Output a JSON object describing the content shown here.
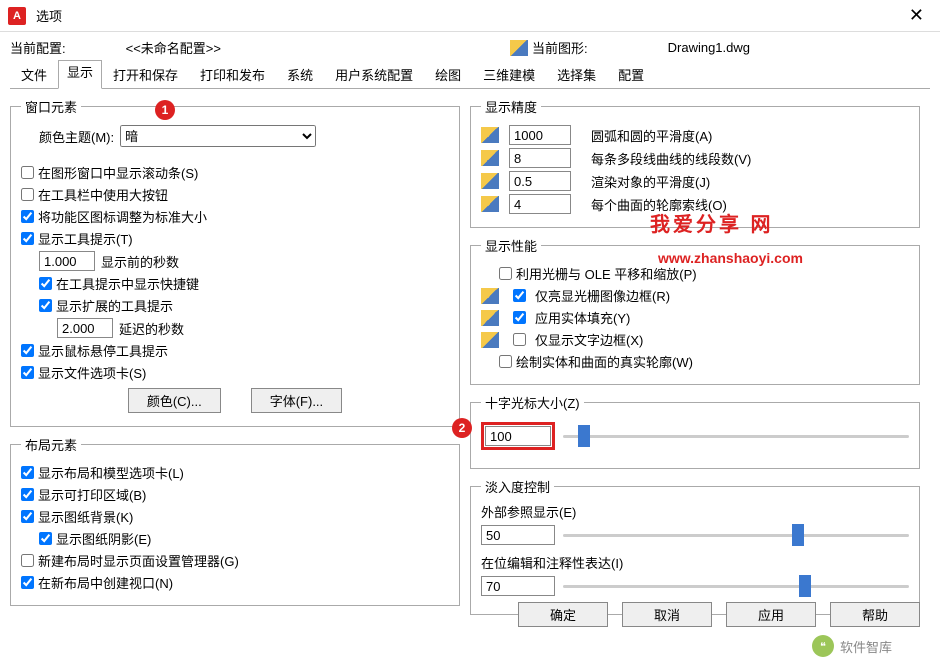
{
  "window": {
    "app_icon_letter": "A",
    "title": "选项",
    "close": "✕"
  },
  "profile": {
    "label": "当前配置:",
    "value": "<<未命名配置>>",
    "drawing_label": "当前图形:",
    "drawing_value": "Drawing1.dwg"
  },
  "tabs": [
    "文件",
    "显示",
    "打开和保存",
    "打印和发布",
    "系统",
    "用户系统配置",
    "绘图",
    "三维建模",
    "选择集",
    "配置"
  ],
  "badges": {
    "one": "1",
    "two": "2"
  },
  "window_elements": {
    "legend": "窗口元素",
    "color_theme_label": "颜色主题(M):",
    "color_theme_value": "暗",
    "scrollbars": "在图形窗口中显示滚动条(S)",
    "large_buttons": "在工具栏中使用大按钮",
    "resize_ribbon": "将功能区图标调整为标准大小",
    "tooltips": "显示工具提示(T)",
    "tooltip_delay_value": "1.000",
    "tooltip_delay_label": "显示前的秒数",
    "tooltip_shortcut": "在工具提示中显示快捷键",
    "tooltip_ext": "显示扩展的工具提示",
    "tooltip_ext_value": "2.000",
    "tooltip_ext_label": "延迟的秒数",
    "rollover": "显示鼠标悬停工具提示",
    "filetabs": "显示文件选项卡(S)",
    "colors_btn": "颜色(C)...",
    "fonts_btn": "字体(F)..."
  },
  "layout_elements": {
    "legend": "布局元素",
    "layout_tabs": "显示布局和模型选项卡(L)",
    "printable": "显示可打印区域(B)",
    "paper_bg": "显示图纸背景(K)",
    "paper_shadow": "显示图纸阴影(E)",
    "page_setup": "新建布局时显示页面设置管理器(G)",
    "viewport": "在新布局中创建视口(N)"
  },
  "display_res": {
    "legend": "显示精度",
    "arc_value": "1000",
    "arc_label": "圆弧和圆的平滑度(A)",
    "seg_value": "8",
    "seg_label": "每条多段线曲线的线段数(V)",
    "render_value": "0.5",
    "render_label": "渲染对象的平滑度(J)",
    "surf_value": "4",
    "surf_label": "每个曲面的轮廓索线(O)"
  },
  "display_perf": {
    "legend": "显示性能",
    "pan_zoom": "利用光栅与 OLE 平移和缩放(P)",
    "highlight": "仅亮显光栅图像边框(R)",
    "solid_fill": "应用实体填充(Y)",
    "text_frame": "仅显示文字边框(X)",
    "silhouette": "绘制实体和曲面的真实轮廓(W)"
  },
  "crosshair": {
    "legend": "十字光标大小(Z)",
    "value": "100"
  },
  "fade": {
    "legend": "淡入度控制",
    "xref_label": "外部参照显示(E)",
    "xref_value": "50",
    "inplace_label": "在位编辑和注释性表达(I)",
    "inplace_value": "70"
  },
  "buttons": {
    "ok": "确定",
    "cancel": "取消",
    "apply": "应用",
    "help": "帮助"
  },
  "watermark": {
    "red": "我爱分享 网",
    "url": "www.zhanshaoyi.com",
    "bottom": "软件智库"
  }
}
